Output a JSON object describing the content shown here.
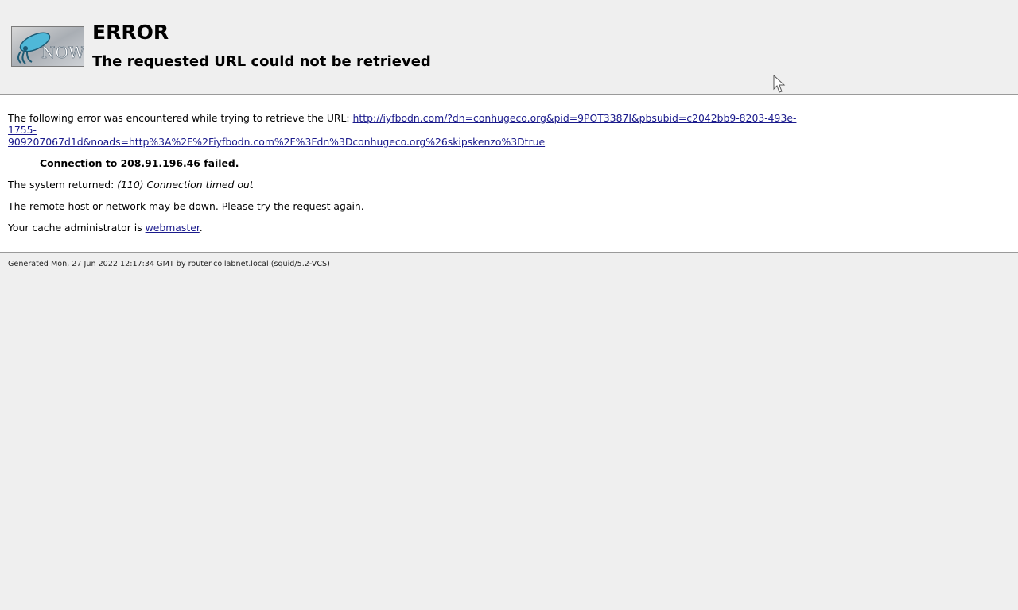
{
  "header": {
    "logo_text": "NOW",
    "title": "ERROR",
    "subtitle": "The requested URL could not be retrieved"
  },
  "content": {
    "intro_text": "The following error was encountered while trying to retrieve the URL: ",
    "url_line1": "http://iyfbodn.com/?dn=conhugeco.org&pid=9POT3387I&pbsubid=c2042bb9-8203-493e-1755-",
    "url_line2": "909207067d1d&noads=http%3A%2F%2Fiyfbodn.com%2F%3Fdn%3Dconhugeco.org%26skipskenzo%3Dtrue",
    "connection_failed": "Connection to 208.91.196.46 failed.",
    "system_returned_label": "The system returned: ",
    "system_returned_value": "(110) Connection timed out",
    "remote_host_msg": "The remote host or network may be down. Please try the request again.",
    "cache_admin_label": "Your cache administrator is ",
    "cache_admin_link": "webmaster",
    "cache_admin_suffix": "."
  },
  "footer": {
    "generated_text": "Generated Mon, 27 Jun 2022 12:17:34 GMT by router.collabnet.local (squid/5.2-VCS)"
  },
  "icons": {
    "logo": "squid-now-logo",
    "cursor": "mouse-pointer-icon"
  }
}
